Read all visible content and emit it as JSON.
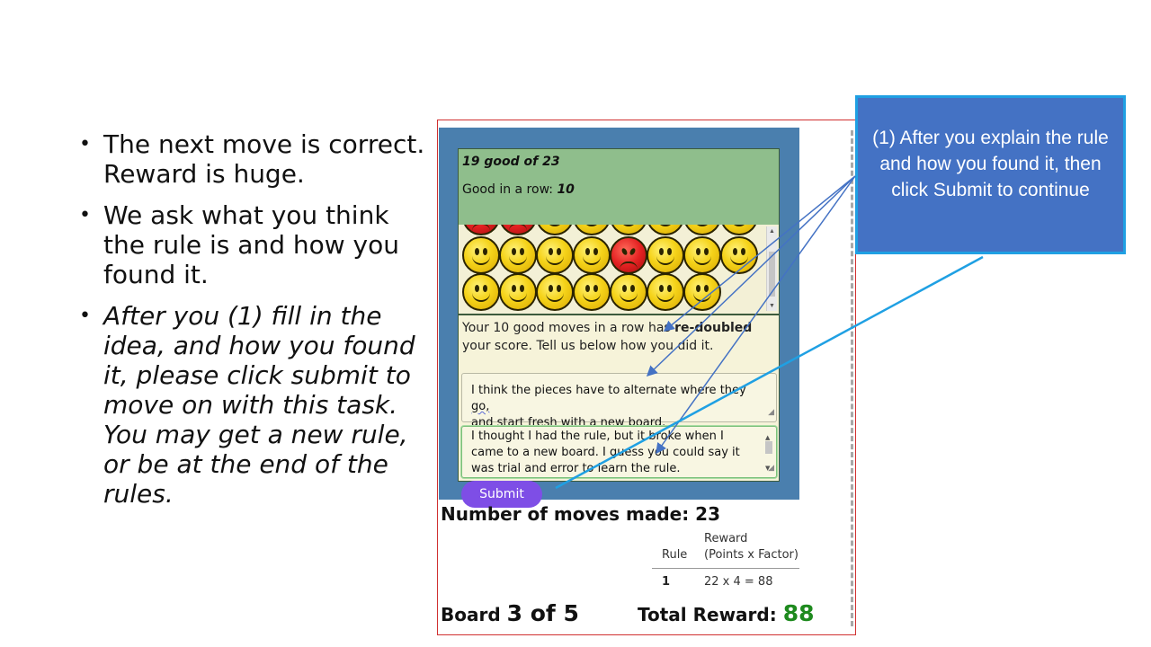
{
  "bullets": [
    {
      "text": "The next move is correct. Reward is huge.",
      "italic": false
    },
    {
      "text": "We ask what you think the rule is and how you found it.",
      "italic": false
    },
    {
      "text": "After you (1)  fill in the idea, and how you found it, please click submit to move on with this task. You may get a new rule, or be at the end of the rules.",
      "italic": true
    }
  ],
  "status": {
    "good_prefix": "19 good of ",
    "good_total": "23",
    "row_label": "Good in a row: ",
    "row_value": "10"
  },
  "faces": {
    "row1": [
      "sad",
      "sad",
      "happy",
      "happy",
      "happy",
      "happy",
      "happy",
      "happy"
    ],
    "row2": [
      "happy",
      "happy",
      "happy",
      "happy",
      "sad",
      "happy",
      "happy",
      "happy"
    ],
    "row3": [
      "happy",
      "happy",
      "happy",
      "happy",
      "happy",
      "happy",
      "happy"
    ]
  },
  "message": {
    "pre": "Your 10 good moves in a row has ",
    "bold": "re-doubled",
    "post": " your score. Tell us below how you did it."
  },
  "rule_answer": {
    "part1": "I think the pieces have to alternate where they ",
    "squig1": "go,",
    "squig2": "and",
    "part2": " start fresh with a new board."
  },
  "how_answer": "I thought I had the rule, but it broke when I came to a new board. I guess you could say it was trial and error to learn the rule.",
  "submit_label": "Submit",
  "moves_label": "Number of moves made: 23",
  "reward_table": {
    "header_reward": "Reward",
    "header_rule": "Rule",
    "header_formula": "(Points x Factor)",
    "rows": [
      {
        "rule": "1",
        "formula": "22 x 4 = 88"
      }
    ]
  },
  "board": {
    "label": "Board ",
    "value": "3 of 5"
  },
  "total": {
    "label": "Total Reward: ",
    "value": "88"
  },
  "callout_text": "(1) After you explain the rule and how you found it, then click Submit to continue",
  "colors": {
    "accent": "#4472c4",
    "submit": "#7e4ee6",
    "total": "#1e8a1e",
    "arrow": "#1fa0e3"
  }
}
